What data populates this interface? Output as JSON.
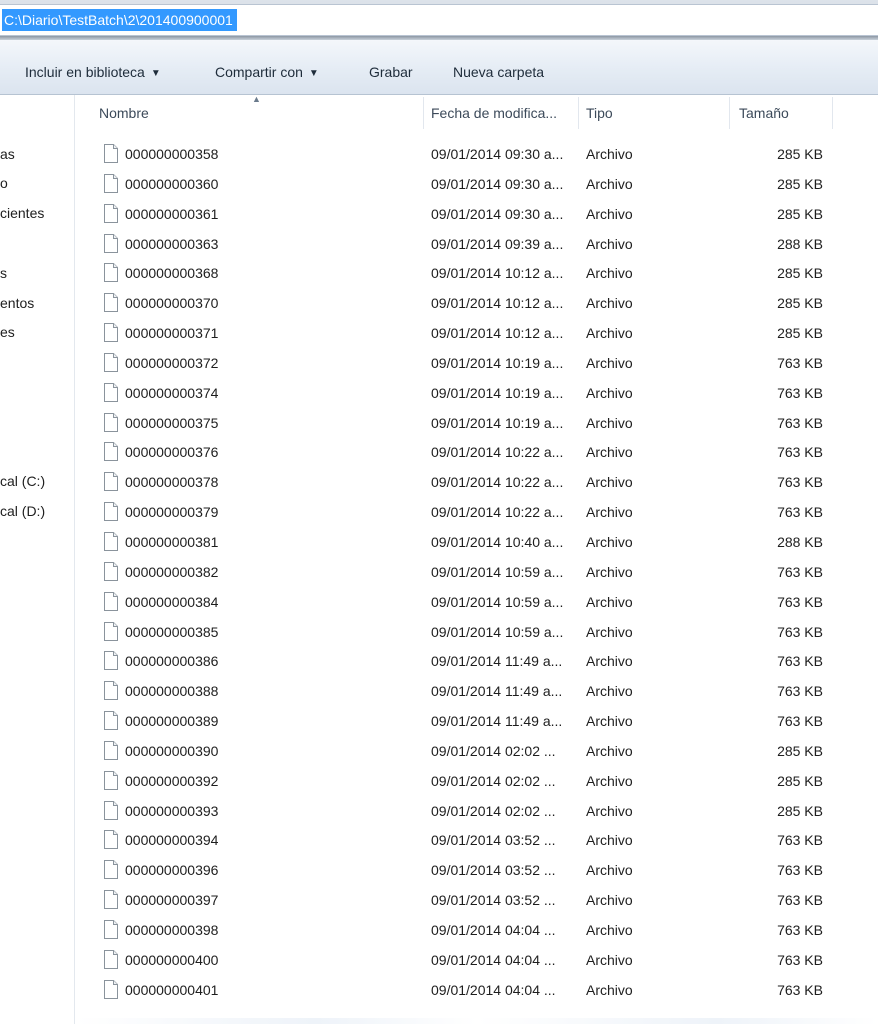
{
  "address": {
    "path": "C:\\Diario\\TestBatch\\2\\201400900001"
  },
  "toolbar": {
    "include_library": "Incluir en biblioteca",
    "share_with": "Compartir con",
    "burn": "Grabar",
    "new_folder": "Nueva carpeta"
  },
  "nav": {
    "items": [
      "as",
      "o",
      "cientes",
      "s",
      "entos",
      "es",
      "cal (C:)",
      "cal (D:)"
    ]
  },
  "columns": {
    "name": "Nombre",
    "date": "Fecha de modifica...",
    "type": "Tipo",
    "size": "Tamaño"
  },
  "files": [
    {
      "name": "000000000358",
      "date": "09/01/2014 09:30 a...",
      "type": "Archivo",
      "size": "285 KB"
    },
    {
      "name": "000000000360",
      "date": "09/01/2014 09:30 a...",
      "type": "Archivo",
      "size": "285 KB"
    },
    {
      "name": "000000000361",
      "date": "09/01/2014 09:30 a...",
      "type": "Archivo",
      "size": "285 KB"
    },
    {
      "name": "000000000363",
      "date": "09/01/2014 09:39 a...",
      "type": "Archivo",
      "size": "288 KB"
    },
    {
      "name": "000000000368",
      "date": "09/01/2014 10:12 a...",
      "type": "Archivo",
      "size": "285 KB"
    },
    {
      "name": "000000000370",
      "date": "09/01/2014 10:12 a...",
      "type": "Archivo",
      "size": "285 KB"
    },
    {
      "name": "000000000371",
      "date": "09/01/2014 10:12 a...",
      "type": "Archivo",
      "size": "285 KB"
    },
    {
      "name": "000000000372",
      "date": "09/01/2014 10:19 a...",
      "type": "Archivo",
      "size": "763 KB"
    },
    {
      "name": "000000000374",
      "date": "09/01/2014 10:19 a...",
      "type": "Archivo",
      "size": "763 KB"
    },
    {
      "name": "000000000375",
      "date": "09/01/2014 10:19 a...",
      "type": "Archivo",
      "size": "763 KB"
    },
    {
      "name": "000000000376",
      "date": "09/01/2014 10:22 a...",
      "type": "Archivo",
      "size": "763 KB"
    },
    {
      "name": "000000000378",
      "date": "09/01/2014 10:22 a...",
      "type": "Archivo",
      "size": "763 KB"
    },
    {
      "name": "000000000379",
      "date": "09/01/2014 10:22 a...",
      "type": "Archivo",
      "size": "763 KB"
    },
    {
      "name": "000000000381",
      "date": "09/01/2014 10:40 a...",
      "type": "Archivo",
      "size": "288 KB"
    },
    {
      "name": "000000000382",
      "date": "09/01/2014 10:59 a...",
      "type": "Archivo",
      "size": "763 KB"
    },
    {
      "name": "000000000384",
      "date": "09/01/2014 10:59 a...",
      "type": "Archivo",
      "size": "763 KB"
    },
    {
      "name": "000000000385",
      "date": "09/01/2014 10:59 a...",
      "type": "Archivo",
      "size": "763 KB"
    },
    {
      "name": "000000000386",
      "date": "09/01/2014 11:49 a...",
      "type": "Archivo",
      "size": "763 KB"
    },
    {
      "name": "000000000388",
      "date": "09/01/2014 11:49 a...",
      "type": "Archivo",
      "size": "763 KB"
    },
    {
      "name": "000000000389",
      "date": "09/01/2014 11:49 a...",
      "type": "Archivo",
      "size": "763 KB"
    },
    {
      "name": "000000000390",
      "date": "09/01/2014 02:02 ...",
      "type": "Archivo",
      "size": "285 KB"
    },
    {
      "name": "000000000392",
      "date": "09/01/2014 02:02 ...",
      "type": "Archivo",
      "size": "285 KB"
    },
    {
      "name": "000000000393",
      "date": "09/01/2014 02:02 ...",
      "type": "Archivo",
      "size": "285 KB"
    },
    {
      "name": "000000000394",
      "date": "09/01/2014 03:52 ...",
      "type": "Archivo",
      "size": "763 KB"
    },
    {
      "name": "000000000396",
      "date": "09/01/2014 03:52 ...",
      "type": "Archivo",
      "size": "763 KB"
    },
    {
      "name": "000000000397",
      "date": "09/01/2014 03:52 ...",
      "type": "Archivo",
      "size": "763 KB"
    },
    {
      "name": "000000000398",
      "date": "09/01/2014 04:04 ...",
      "type": "Archivo",
      "size": "763 KB"
    },
    {
      "name": "000000000400",
      "date": "09/01/2014 04:04 ...",
      "type": "Archivo",
      "size": "763 KB"
    },
    {
      "name": "000000000401",
      "date": "09/01/2014 04:04 ...",
      "type": "Archivo",
      "size": "763 KB"
    }
  ],
  "icons": {
    "file": "document-icon",
    "sort": "sort-ascending-icon",
    "dropdown": "chevron-down-icon"
  },
  "colors": {
    "selection": "#3399ff",
    "toolbar_text": "#1e2c3a",
    "header_text": "#3c4a5a"
  }
}
